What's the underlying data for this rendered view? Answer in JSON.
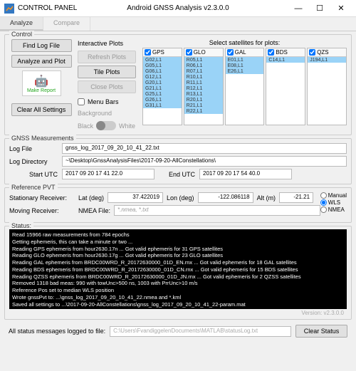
{
  "titlebar": {
    "app_name": "CONTROL PANEL",
    "center": "Android GNSS Analysis      v2.3.0.0"
  },
  "tabs": {
    "analyze": "Analyze",
    "compare": "Compare"
  },
  "control": {
    "title": "Control",
    "find_log": "Find Log File",
    "analyze_plot": "Analyze and Plot",
    "make_report": "Make Report",
    "clear_all": "Clear All Settings"
  },
  "plots": {
    "title": "Interactive Plots",
    "refresh": "Refresh Plots",
    "tile": "Tile Plots",
    "close": "Close Plots",
    "menu_bars": "Menu Bars",
    "background": "Background",
    "black": "Black",
    "white": "White"
  },
  "sats": {
    "title": "Select satellites for plots:",
    "constellations": [
      {
        "name": "GPS",
        "items": [
          "G02,L1",
          "G05,L1",
          "G06,L1",
          "G12,L1",
          "G20,L1",
          "G21,L1",
          "G25,L1",
          "G26,L1",
          "G31,L1"
        ]
      },
      {
        "name": "GLO",
        "items": [
          "R05,L1",
          "R06,L1",
          "R07,L1",
          "R10,L1",
          "R11,L1",
          "R12,L1",
          "R13,L1",
          "R20,L1",
          "R21,L1",
          "R22,L1"
        ]
      },
      {
        "name": "GAL",
        "items": [
          "E01,L1",
          "E08,L1",
          "E26,L1"
        ]
      },
      {
        "name": "BDS",
        "items": [
          "C14,L1"
        ]
      },
      {
        "name": "QZS",
        "items": [
          "J194,L1"
        ]
      }
    ]
  },
  "gnss": {
    "title": "GNSS Measurements",
    "log_file_lbl": "Log File",
    "log_file": "gnss_log_2017_09_20_10_41_22.txt",
    "log_dir_lbl": "Log Directory",
    "log_dir": "~\\Desktop\\GnssAnalysisFiles\\2017-09-20-AllConstellations\\",
    "start_lbl": "Start UTC",
    "start": "2017 09 20 17 41 22.0",
    "end_lbl": "End UTC",
    "end": "2017 09 20 17 54 40.0"
  },
  "pvt": {
    "title": "Reference PVT",
    "stationary": "Stationary Receiver:",
    "lat_lbl": "Lat (deg)",
    "lat": "37.422019",
    "lon_lbl": "Lon (deg)",
    "lon": "-122.086118",
    "alt_lbl": "Alt (m)",
    "alt": "-21.21",
    "moving": "Moving Receiver:",
    "nmea_lbl": "NMEA File:",
    "nmea": "*.nmea, *.txt",
    "manual": "Manual",
    "wls": "WLS",
    "nmea_radio": "NMEA"
  },
  "status": {
    "title": "Status:",
    "lines": [
      "Read 15966 raw measurements from 784 epochs",
      "Getting ephemeris, this can take a minute or two ...",
      "Reading GPS ephemeris from hour2630.17n ... Got valid ephemeris for 31 GPS satellites",
      "Reading GLO ephemeris from hour2630.17g ... Got valid ephemeris for 23 GLO satellites",
      "Reading GAL ephemeris from BRDC00WRD_R_20172630000_01D_EN.rnx ... Got valid ephemeris for 18 GAL satellites",
      "Reading BDS ephemeris from BRDC00WRD_R_20172630000_01D_CN.rnx ... Got valid ephemeris for 15 BDS satellites",
      "Reading QZSS ephemeris from BRDC00WRD_R_20172630000_01D_JN.rnx ... Got valid ephemeris for 2 QZSS satellites",
      "Removed 1318 bad meas: 990 with towUnc>500 ns, 1003 with PrrUnc>10 m/s",
      "Reference Pos set to median WLS position",
      "Wrote gnssPvt to: ...\\gnss_log_2017_09_20_10_41_22.nmea and *.kml",
      "Saved all settings to ...\\2017-09-20-AllConstellations\\gnss_log_2017_09_20_10_41_22-param.mat"
    ],
    "version": "Version:   v2.3.0.0"
  },
  "footer": {
    "label": "All status messages logged to file:",
    "path": "C:\\Users\\FvandiggelenDocuments\\MATLAB\\statusLog.txt",
    "clear": "Clear Status"
  }
}
